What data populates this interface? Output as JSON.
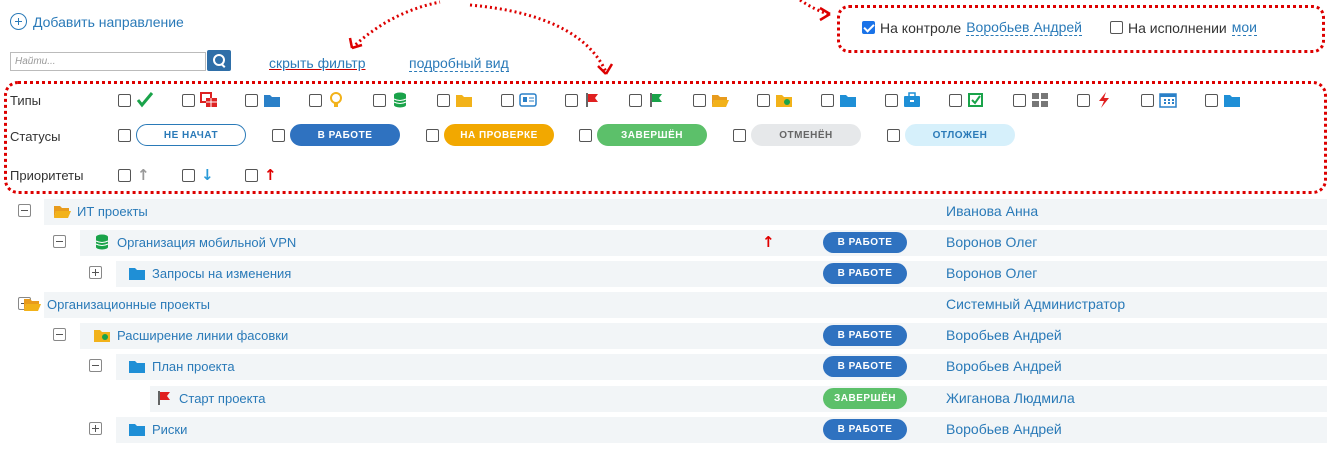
{
  "header": {
    "add_direction": "Добавить направление",
    "search_placeholder": "Найти...",
    "hide_filter": "скрыть фильтр",
    "detail_view": "подробный вид"
  },
  "control": {
    "on_control_label": "На контроле",
    "on_control_checked": true,
    "on_control_user": "Воробьев Андрей",
    "on_execution_label": "На исполнении",
    "on_execution_checked": false,
    "on_execution_user": "мои"
  },
  "filters": {
    "types_label": "Типы",
    "statuses_label": "Статусы",
    "priorities_label": "Приоритеты",
    "types": [
      {
        "icon": "check-icon"
      },
      {
        "icon": "table-icon"
      },
      {
        "icon": "folder-icon"
      },
      {
        "icon": "lightbulb-icon"
      },
      {
        "icon": "database-icon"
      },
      {
        "icon": "folder-yellow-icon"
      },
      {
        "icon": "card-icon"
      },
      {
        "icon": "flag-red-icon"
      },
      {
        "icon": "flag-green-icon"
      },
      {
        "icon": "folder-open-icon"
      },
      {
        "icon": "folder-user-icon"
      },
      {
        "icon": "folder-blue-icon"
      },
      {
        "icon": "briefcase-icon"
      },
      {
        "icon": "checkbox-green-icon"
      },
      {
        "icon": "grid-icon"
      },
      {
        "icon": "lightning-icon"
      },
      {
        "icon": "calendar-icon"
      },
      {
        "icon": "folder-blue-2-icon"
      }
    ],
    "statuses": [
      {
        "label": "НЕ НАЧАТ",
        "bg": "#ffffff",
        "fg": "#2a7ab8",
        "border": "#2a7ab8"
      },
      {
        "label": "В РАБОТЕ",
        "bg": "#2f72c0",
        "fg": "#ffffff",
        "border": "#2f72c0"
      },
      {
        "label": "НА ПРОВЕРКЕ",
        "bg": "#f2a800",
        "fg": "#ffffff",
        "border": "#f2a800"
      },
      {
        "label": "ЗАВЕРШЁН",
        "bg": "#5cc06a",
        "fg": "#ffffff",
        "border": "#5cc06a"
      },
      {
        "label": "ОТМЕНЁН",
        "bg": "#e6e8ea",
        "fg": "#666666",
        "border": "#e6e8ea"
      },
      {
        "label": "ОТЛОЖЕН",
        "bg": "#d6f0fb",
        "fg": "#2a7ab8",
        "border": "#d6f0fb"
      }
    ],
    "priorities": [
      {
        "icon": "arrow-up-grey-icon",
        "glyph": "↑",
        "color": "#999999"
      },
      {
        "icon": "arrow-down-blue-icon",
        "glyph": "↓",
        "color": "#2a9ad8"
      },
      {
        "icon": "arrow-up-red-icon",
        "glyph": "↑",
        "color": "#e00000"
      }
    ]
  },
  "rows": [
    {
      "title": "ИТ проекты",
      "owner": "Иванова Анна",
      "status": "",
      "priority": ""
    },
    {
      "title": "Организация мобильной VPN",
      "owner": "Воронов Олег",
      "status": "В РАБОТЕ",
      "priority": "↑"
    },
    {
      "title": "Запросы на изменения",
      "owner": "Воронов Олег",
      "status": "В РАБОТЕ",
      "priority": ""
    },
    {
      "title": "Организационные проекты",
      "owner": "Системный Администратор",
      "status": "",
      "priority": ""
    },
    {
      "title": "Расширение линии фасовки",
      "owner": "Воробьев Андрей",
      "status": "В РАБОТЕ",
      "priority": ""
    },
    {
      "title": "План проекта",
      "owner": "Воробьев Андрей",
      "status": "В РАБОТЕ",
      "priority": ""
    },
    {
      "title": "Старт проекта",
      "owner": "Жиганова Людмила",
      "status": "ЗАВЕРШЁН",
      "priority": ""
    },
    {
      "title": "Риски",
      "owner": "Воробьев Андрей",
      "status": "В РАБОТЕ",
      "priority": ""
    }
  ],
  "colors": {
    "accent": "#2a7ab8",
    "in_work": "#2f72c0",
    "done": "#5cc06a",
    "annotation": "#dd0000"
  }
}
